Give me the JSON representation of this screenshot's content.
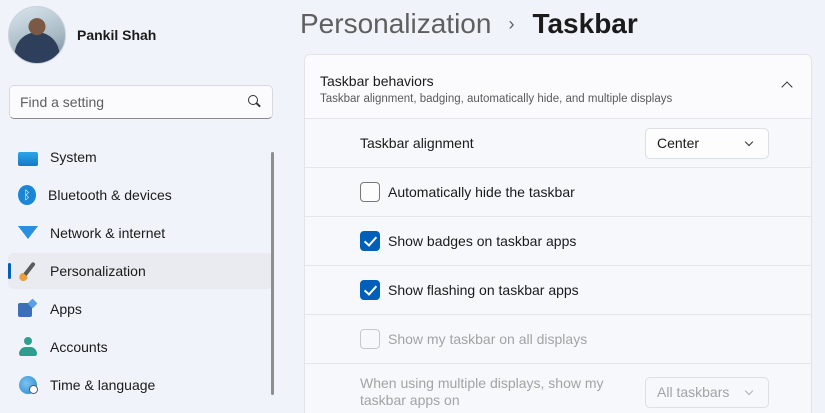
{
  "profile": {
    "name": "Pankil Shah"
  },
  "search": {
    "placeholder": "Find a setting"
  },
  "sidebar": {
    "items": [
      {
        "label": "System",
        "icon": "system-icon"
      },
      {
        "label": "Bluetooth & devices",
        "icon": "bluetooth-icon"
      },
      {
        "label": "Network & internet",
        "icon": "wifi-icon"
      },
      {
        "label": "Personalization",
        "icon": "brush-icon",
        "active": true
      },
      {
        "label": "Apps",
        "icon": "apps-icon"
      },
      {
        "label": "Accounts",
        "icon": "person-icon"
      },
      {
        "label": "Time & language",
        "icon": "globe-clock-icon"
      }
    ]
  },
  "breadcrumb": {
    "parent": "Personalization",
    "separator": "›",
    "current": "Taskbar"
  },
  "section": {
    "title": "Taskbar behaviors",
    "subtitle": "Taskbar alignment, badging, automatically hide, and multiple displays"
  },
  "settings": {
    "alignment": {
      "label": "Taskbar alignment",
      "value": "Center"
    },
    "auto_hide": {
      "label": "Automatically hide the taskbar",
      "checked": false
    },
    "badges": {
      "label": "Show badges on taskbar apps",
      "checked": true
    },
    "flashing": {
      "label": "Show flashing on taskbar apps",
      "checked": true
    },
    "all_displays": {
      "label": "Show my taskbar on all displays",
      "checked": false,
      "disabled": true
    },
    "multi_display": {
      "label": "When using multiple displays, show my taskbar apps on",
      "value": "All taskbars",
      "disabled": true
    }
  },
  "colors": {
    "accent": "#005fb8",
    "background": "#f0f3f9"
  }
}
